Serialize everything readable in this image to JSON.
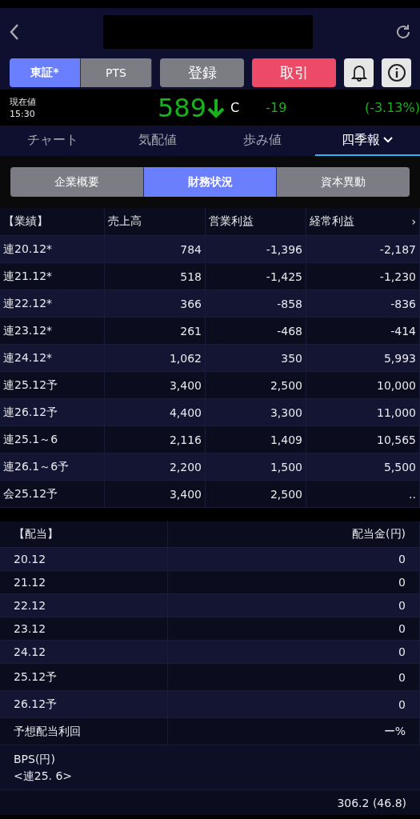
{
  "header": {
    "title_redacted": true
  },
  "market_toggle": [
    {
      "label": "東証*",
      "selected": true
    },
    {
      "label": "PTS",
      "selected": false
    }
  ],
  "actions": [
    {
      "label": "登録",
      "kind": "neutral"
    },
    {
      "label": "取引",
      "kind": "primary"
    }
  ],
  "quote": {
    "label": "現在値",
    "time": "15:30",
    "price": "589",
    "falling": true,
    "flag": "C",
    "change": "-19",
    "change_pct": "(-3.13%)"
  },
  "tabs": [
    {
      "label": "チャート",
      "selected": false,
      "dropdown": false
    },
    {
      "label": "気配値",
      "selected": false,
      "dropdown": false
    },
    {
      "label": "歩み値",
      "selected": false,
      "dropdown": false
    },
    {
      "label": "四季報",
      "selected": true,
      "dropdown": true
    }
  ],
  "subtabs": [
    {
      "label": "企業概要",
      "selected": false
    },
    {
      "label": "財務状況",
      "selected": true
    },
    {
      "label": "資本異動",
      "selected": false
    }
  ],
  "results_table": {
    "columns": [
      "【業績】",
      "売上高",
      "営業利益",
      "経常利益"
    ],
    "more": "›",
    "rows": [
      [
        "連20.12*",
        "784",
        "-1,396",
        "-2,187"
      ],
      [
        "連21.12*",
        "518",
        "-1,425",
        "-1,230"
      ],
      [
        "連22.12*",
        "366",
        "-858",
        "-836"
      ],
      [
        "連23.12*",
        "261",
        "-468",
        "-414"
      ],
      [
        "連24.12*",
        "1,062",
        "350",
        "5,993"
      ],
      [
        "連25.12予",
        "3,400",
        "2,500",
        "10,000"
      ],
      [
        "連26.12予",
        "4,400",
        "3,300",
        "11,000"
      ],
      [
        "連25.1～6",
        "2,116",
        "1,409",
        "10,565"
      ],
      [
        "連26.1～6予",
        "2,200",
        "1,500",
        "5,500"
      ],
      [
        "会25.12予",
        "3,400",
        "2,500",
        ".."
      ]
    ]
  },
  "dividend_table": {
    "columns": [
      "【配当】",
      "配当金(円)"
    ],
    "rows": [
      [
        "20.12",
        "0"
      ],
      [
        "21.12",
        "0"
      ],
      [
        "22.12",
        "0"
      ],
      [
        "23.12",
        "0"
      ],
      [
        "24.12",
        "0"
      ],
      [
        "25.12予",
        "0"
      ],
      [
        "26.12予",
        "0"
      ],
      [
        "予想配当利回",
        "ー%"
      ]
    ]
  },
  "bps": {
    "label": "BPS(円)",
    "basis": "<連25. 6>",
    "value": "306.2 (46.8)"
  }
}
